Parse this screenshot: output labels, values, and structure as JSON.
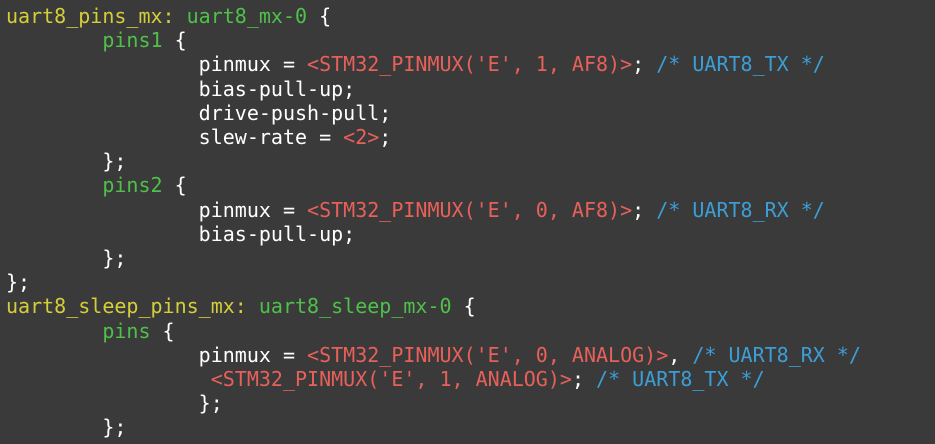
{
  "colors": {
    "background": "#3a3a3a",
    "label": "#d5ce3a",
    "node": "#4fc04a",
    "plain": "#ffffff",
    "macro": "#e8605a",
    "comment": "#3b9ed6"
  },
  "code": {
    "lines": [
      {
        "tokens": [
          {
            "type": "label",
            "text": "uart8_pins_mx:"
          },
          {
            "type": "plain",
            "text": " "
          },
          {
            "type": "node",
            "text": "uart8_mx-0"
          },
          {
            "type": "plain",
            "text": " {"
          }
        ]
      },
      {
        "tokens": [
          {
            "type": "plain",
            "text": "        "
          },
          {
            "type": "node",
            "text": "pins1"
          },
          {
            "type": "plain",
            "text": " {"
          }
        ]
      },
      {
        "tokens": [
          {
            "type": "plain",
            "text": "                pinmux = "
          },
          {
            "type": "macro",
            "text": "<STM32_PINMUX('E', 1, AF8)>"
          },
          {
            "type": "plain",
            "text": "; "
          },
          {
            "type": "comment",
            "text": "/* UART8_TX */"
          }
        ]
      },
      {
        "tokens": [
          {
            "type": "plain",
            "text": "                bias-pull-up;"
          }
        ]
      },
      {
        "tokens": [
          {
            "type": "plain",
            "text": "                drive-push-pull;"
          }
        ]
      },
      {
        "tokens": [
          {
            "type": "plain",
            "text": "                slew-rate = "
          },
          {
            "type": "macro",
            "text": "<2>"
          },
          {
            "type": "plain",
            "text": ";"
          }
        ]
      },
      {
        "tokens": [
          {
            "type": "plain",
            "text": "        };"
          }
        ]
      },
      {
        "tokens": [
          {
            "type": "plain",
            "text": "        "
          },
          {
            "type": "node",
            "text": "pins2"
          },
          {
            "type": "plain",
            "text": " {"
          }
        ]
      },
      {
        "tokens": [
          {
            "type": "plain",
            "text": "                pinmux = "
          },
          {
            "type": "macro",
            "text": "<STM32_PINMUX('E', 0, AF8)>"
          },
          {
            "type": "plain",
            "text": "; "
          },
          {
            "type": "comment",
            "text": "/* UART8_RX */"
          }
        ]
      },
      {
        "tokens": [
          {
            "type": "plain",
            "text": "                bias-pull-up;"
          }
        ]
      },
      {
        "tokens": [
          {
            "type": "plain",
            "text": "        };"
          }
        ]
      },
      {
        "tokens": [
          {
            "type": "plain",
            "text": "};"
          }
        ]
      },
      {
        "tokens": [
          {
            "type": "label",
            "text": "uart8_sleep_pins_mx:"
          },
          {
            "type": "plain",
            "text": " "
          },
          {
            "type": "node",
            "text": "uart8_sleep_mx-0"
          },
          {
            "type": "plain",
            "text": " {"
          }
        ]
      },
      {
        "tokens": [
          {
            "type": "plain",
            "text": "        "
          },
          {
            "type": "node",
            "text": "pins"
          },
          {
            "type": "plain",
            "text": " {"
          }
        ]
      },
      {
        "tokens": [
          {
            "type": "plain",
            "text": "                pinmux = "
          },
          {
            "type": "macro",
            "text": "<STM32_PINMUX('E', 0, ANALOG)>"
          },
          {
            "type": "plain",
            "text": ", "
          },
          {
            "type": "comment",
            "text": "/* UART8_RX */"
          }
        ]
      },
      {
        "tokens": [
          {
            "type": "plain",
            "text": "                 "
          },
          {
            "type": "macro",
            "text": "<STM32_PINMUX('E', 1, ANALOG)>"
          },
          {
            "type": "plain",
            "text": "; "
          },
          {
            "type": "comment",
            "text": "/* UART8_TX */"
          }
        ]
      },
      {
        "tokens": [
          {
            "type": "plain",
            "text": "                };"
          }
        ]
      },
      {
        "tokens": [
          {
            "type": "plain",
            "text": "        };"
          }
        ]
      }
    ]
  }
}
